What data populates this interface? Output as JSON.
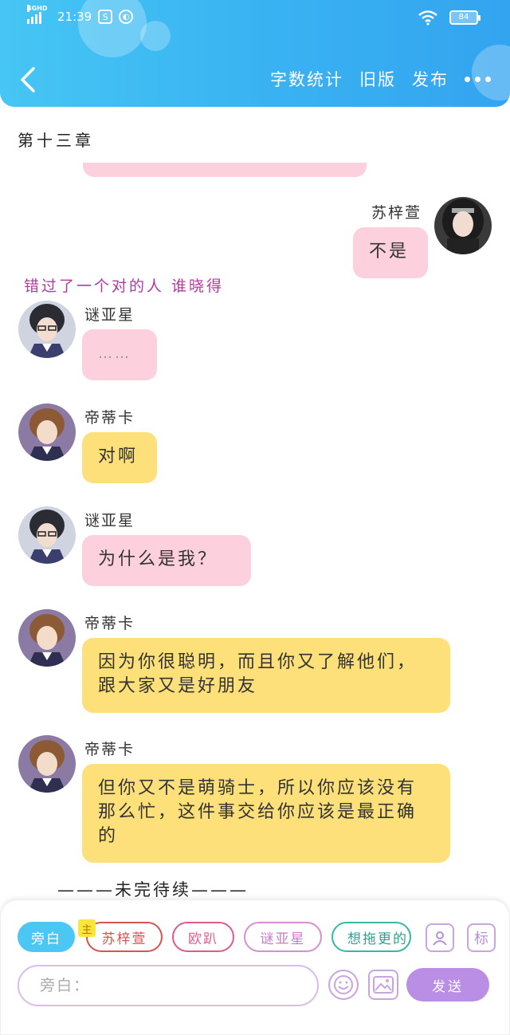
{
  "status_bar": {
    "network": "4GHD",
    "time": "21:39",
    "battery": "84"
  },
  "nav": {
    "back_icon": "chevron-left-icon",
    "word_count": "字数统计",
    "old_version": "旧版",
    "publish": "发布"
  },
  "chapter": {
    "title": "第十三章"
  },
  "messages": [
    {
      "side": "right",
      "name": "苏梓萱",
      "text": "不是",
      "color": "pink"
    },
    {
      "side": "left",
      "name": "谜亚星",
      "text": "……",
      "color": "pink"
    },
    {
      "side": "left",
      "name": "帝蒂卡",
      "text": "对啊",
      "color": "yellow"
    },
    {
      "side": "left",
      "name": "谜亚星",
      "text": "为什么是我？",
      "color": "pink"
    },
    {
      "side": "left",
      "name": "帝蒂卡",
      "text": "因为你很聪明，而且你又了解他们，跟大家又是好朋友",
      "color": "yellow"
    },
    {
      "side": "left",
      "name": "帝蒂卡",
      "text": "但你又不是萌骑士，所以你应该没有那么忙，这件事交给你应该是最正确的",
      "color": "yellow"
    }
  ],
  "narration": "错过了一个对的人 谁晓得",
  "end_text": "———未完待续———",
  "role_chips": {
    "narrator": "旁白",
    "main_badge": "主",
    "role1": "苏梓萱",
    "role2": "欧趴",
    "role3": "谜亚星",
    "role4": "想拖更的"
  },
  "tools": {
    "mark_label": "标"
  },
  "input": {
    "placeholder": "旁白："
  },
  "send_label": "发送",
  "colors": {
    "header_start": "#46c6f4",
    "header_end": "#33a4f0",
    "pink_bubble": "#fcd0dc",
    "yellow_bubble": "#fde07a",
    "narration": "#b03a9e",
    "send": "#bb8ee6"
  }
}
